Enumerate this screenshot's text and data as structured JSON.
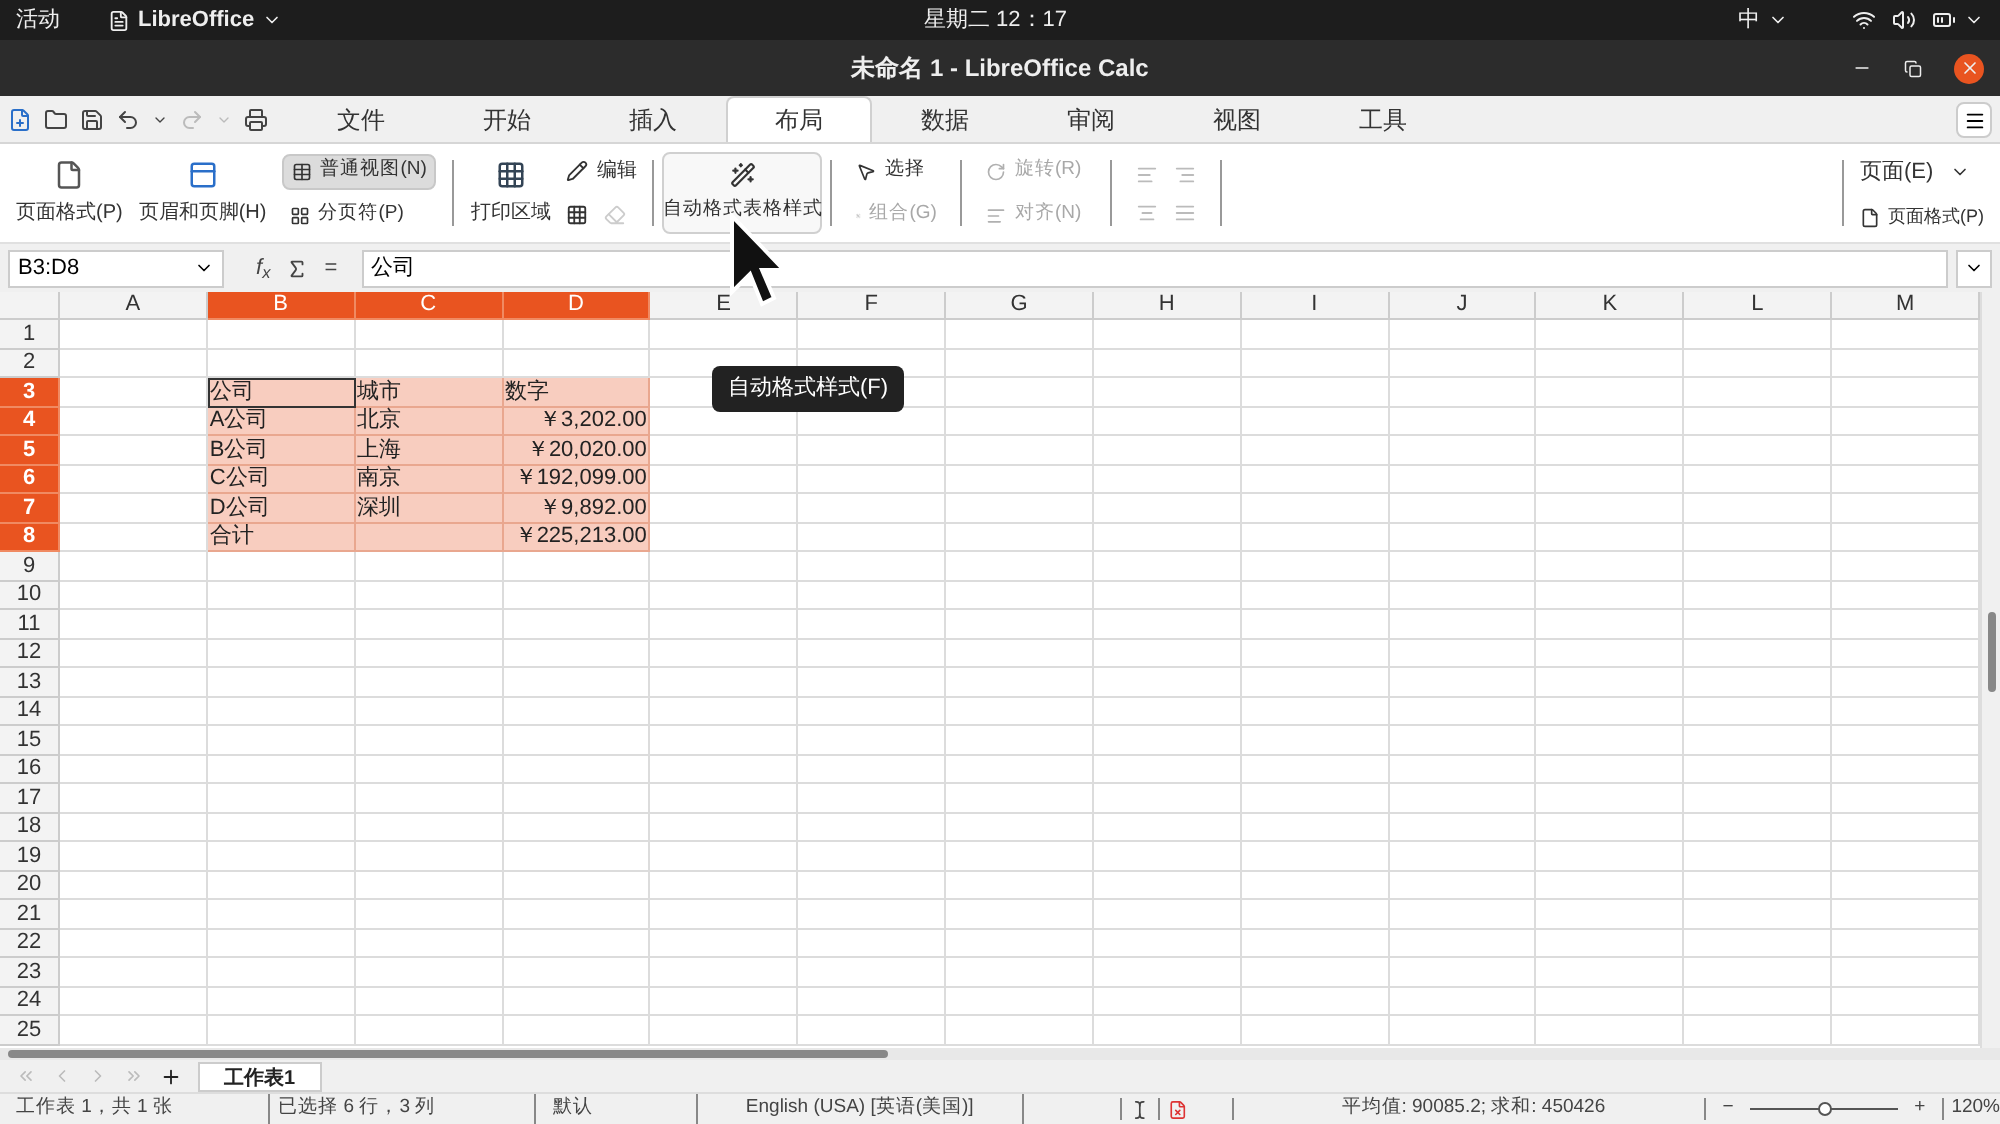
{
  "top_bar": {
    "activities": "活动",
    "app_menu": "LibreOffice",
    "clock": "星期二 12：17",
    "input_method": "中"
  },
  "window": {
    "title": "未命名 1 - LibreOffice Calc"
  },
  "tabs": [
    {
      "label": "文件",
      "selected": false
    },
    {
      "label": "开始",
      "selected": false
    },
    {
      "label": "插入",
      "selected": false
    },
    {
      "label": "布局",
      "selected": true
    },
    {
      "label": "数据",
      "selected": false
    },
    {
      "label": "审阅",
      "selected": false
    },
    {
      "label": "视图",
      "selected": false
    },
    {
      "label": "工具",
      "selected": false
    }
  ],
  "ribbon": {
    "page_format": "页面格式(P)",
    "header_footer": "页眉和页脚(H)",
    "normal_view": {
      "label": "普通视图(N)",
      "pressed": true
    },
    "page_break": {
      "label": "分页符(P)",
      "pressed": false
    },
    "print_area": "打印区域",
    "edit": "编辑",
    "autoformat": {
      "label": "自动格式表格样式",
      "hovered": true
    },
    "select": {
      "label": "选择",
      "disabled": false
    },
    "group": {
      "label": "组合(G)",
      "disabled": true
    },
    "rotate": {
      "label": "旋转(R)",
      "disabled": true
    },
    "align": {
      "label": "对齐(N)",
      "disabled": true
    },
    "page_menu": "页面(E)",
    "page_style": "页面格式(P)"
  },
  "name_box": "B3:D8",
  "function_wizard": "f$_{x}$",
  "formula_sign": "=",
  "formula": "公司",
  "columns": [
    {
      "label": "A",
      "selected": false
    },
    {
      "label": "B",
      "selected": true
    },
    {
      "label": "C",
      "selected": true
    },
    {
      "label": "D",
      "selected": true
    },
    {
      "label": "E",
      "selected": false
    },
    {
      "label": "F",
      "selected": false
    },
    {
      "label": "G",
      "selected": false
    },
    {
      "label": "H",
      "selected": false
    },
    {
      "label": "I",
      "selected": false
    },
    {
      "label": "J",
      "selected": false
    },
    {
      "label": "K",
      "selected": false
    },
    {
      "label": "L",
      "selected": false
    },
    {
      "label": "M",
      "selected": false
    }
  ],
  "rows": [
    {
      "label": "1",
      "selected": false
    },
    {
      "label": "2",
      "selected": false
    },
    {
      "label": "3",
      "selected": true,
      "cells": {
        "B": {
          "text": "公司",
          "kind": "text",
          "active": true
        },
        "C": {
          "text": "城市",
          "kind": "text",
          "active": false
        },
        "D": {
          "text": "数字",
          "kind": "text",
          "active": false
        }
      }
    },
    {
      "label": "4",
      "selected": true,
      "cells": {
        "B": {
          "text": "A公司",
          "kind": "text",
          "active": false
        },
        "C": {
          "text": "北京",
          "kind": "text",
          "active": false
        },
        "D": {
          "text": "￥3,202.00",
          "kind": "number",
          "active": false
        }
      }
    },
    {
      "label": "5",
      "selected": true,
      "cells": {
        "B": {
          "text": "B公司",
          "kind": "text",
          "active": false
        },
        "C": {
          "text": "上海",
          "kind": "text",
          "active": false
        },
        "D": {
          "text": "￥20,020.00",
          "kind": "number",
          "active": false
        }
      }
    },
    {
      "label": "6",
      "selected": true,
      "cells": {
        "B": {
          "text": "C公司",
          "kind": "text",
          "active": false
        },
        "C": {
          "text": "南京",
          "kind": "text",
          "active": false
        },
        "D": {
          "text": "￥192,099.00",
          "kind": "number",
          "active": false
        }
      }
    },
    {
      "label": "7",
      "selected": true,
      "cells": {
        "B": {
          "text": "D公司",
          "kind": "text",
          "active": false
        },
        "C": {
          "text": "深圳",
          "kind": "text",
          "active": false
        },
        "D": {
          "text": "￥9,892.00",
          "kind": "number",
          "active": false
        }
      }
    },
    {
      "label": "8",
      "selected": true,
      "cells": {
        "B": {
          "text": "合计",
          "kind": "text",
          "active": false
        },
        "D": {
          "text": "￥225,213.00",
          "kind": "number",
          "active": false
        }
      }
    },
    {
      "label": "9",
      "selected": false
    },
    {
      "label": "10",
      "selected": false
    },
    {
      "label": "11",
      "selected": false
    },
    {
      "label": "12",
      "selected": false
    },
    {
      "label": "13",
      "selected": false
    },
    {
      "label": "14",
      "selected": false
    },
    {
      "label": "15",
      "selected": false
    },
    {
      "label": "16",
      "selected": false
    },
    {
      "label": "17",
      "selected": false
    },
    {
      "label": "18",
      "selected": false
    },
    {
      "label": "19",
      "selected": false
    },
    {
      "label": "20",
      "selected": false
    },
    {
      "label": "21",
      "selected": false
    },
    {
      "label": "22",
      "selected": false
    },
    {
      "label": "23",
      "selected": false
    },
    {
      "label": "24",
      "selected": false
    },
    {
      "label": "25",
      "selected": false
    }
  ],
  "tooltip": "自动格式样式(F)",
  "sheet_tabs": [
    {
      "label": "工作表1",
      "selected": true
    }
  ],
  "status_bar": {
    "sheet": "工作表 1，共 1 张",
    "selection": "已选择 6 行，3 列",
    "style": "默认",
    "language": "English (USA) [英语(美国)]",
    "summary": "平均值: 90085.2; 求和: 450426",
    "zoom_out": "−",
    "zoom_in": "+",
    "zoom": {
      "level": 0.5
    },
    "zoom_text": "120%"
  }
}
